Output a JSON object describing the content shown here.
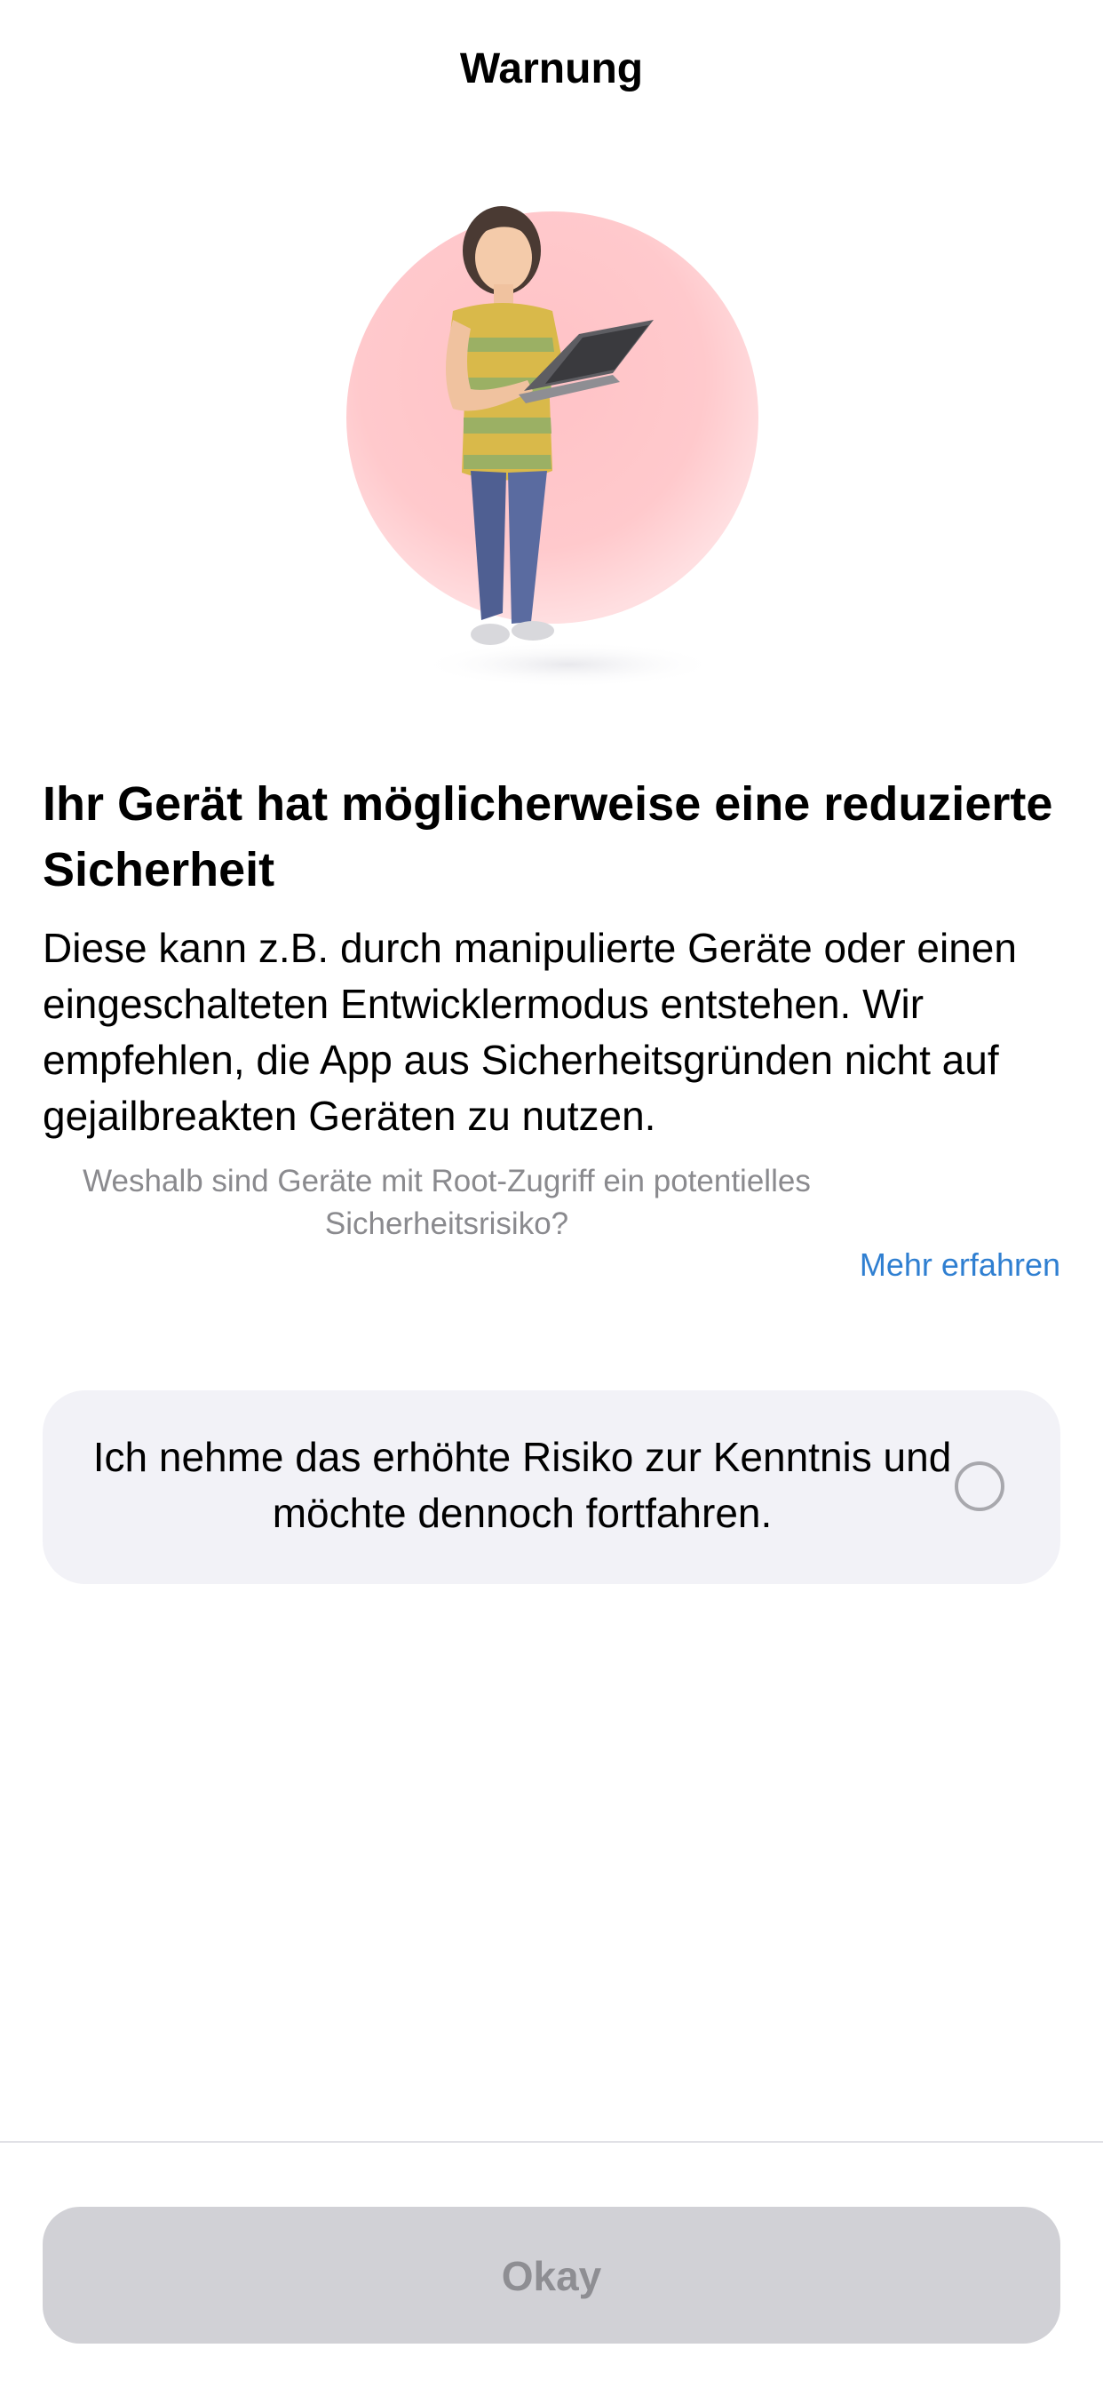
{
  "header": {
    "title": "Warnung"
  },
  "illustration": {
    "icon": "woman-with-laptop-illustration",
    "circle_color": "#ffc9cc"
  },
  "content": {
    "headline": "Ihr Gerät hat möglicherweise eine reduzierte Sicherheit",
    "body": "Diese kann z.B. durch manipulierte Geräte oder einen eingeschalteten Entwicklermodus entstehen. Wir empfehlen, die App aus Sicherheitsgründen nicht auf gejailbreakten Geräten zu nutzen.",
    "question": "Weshalb sind Geräte mit Root-Zugriff ein potentielles Sicherheitsrisiko?",
    "more_link": "Mehr erfahren"
  },
  "acknowledge": {
    "label": "Ich nehme das erhöhte Risiko zur Kenntnis und möchte dennoch fortfahren.",
    "checked": false
  },
  "footer": {
    "okay_label": "Okay",
    "okay_enabled": false
  },
  "colors": {
    "link": "#2f7fd1",
    "card_background": "#f2f2f7",
    "button_disabled_background": "#d1d1d6",
    "button_disabled_text": "#8e8e93"
  }
}
